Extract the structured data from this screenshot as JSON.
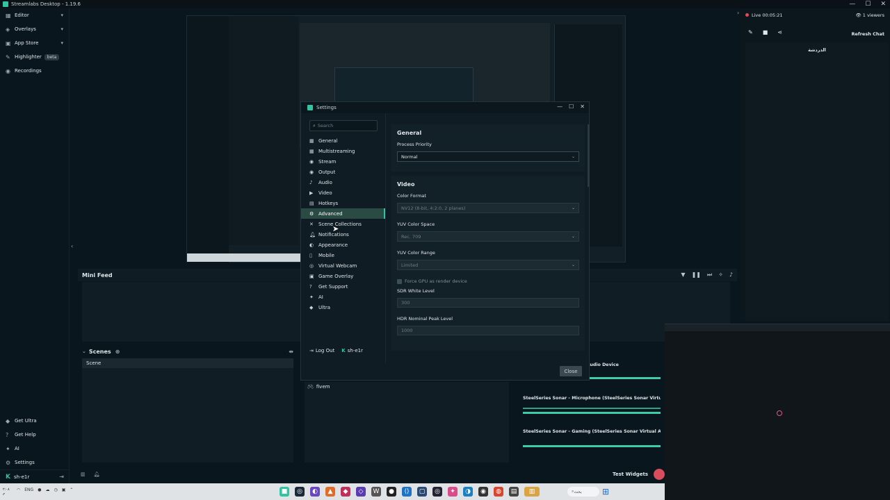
{
  "window": {
    "title": "Streamlabs Desktop - 1.19.6",
    "controls": [
      "—",
      "☐",
      "✕"
    ]
  },
  "left_nav": {
    "items": [
      {
        "label": "Editor",
        "icon": "editor-icon",
        "chevron": true
      },
      {
        "label": "Overlays",
        "icon": "overlays-icon",
        "chevron": true
      },
      {
        "label": "App Store",
        "icon": "app-store-icon",
        "chevron": true
      },
      {
        "label": "Highlighter",
        "icon": "highlighter-icon",
        "badge": "beta"
      },
      {
        "label": "Recordings",
        "icon": "recordings-icon"
      }
    ],
    "bottom_items": [
      {
        "label": "Get Ultra",
        "icon": "ultra-icon"
      },
      {
        "label": "Get Help",
        "icon": "help-icon"
      },
      {
        "label": "AI",
        "icon": "ai-icon"
      },
      {
        "label": "Settings",
        "icon": "gear-icon"
      }
    ],
    "user": "sh-e1r"
  },
  "mini_feed": {
    "label": "Mini Feed"
  },
  "scenes": {
    "label": "Scenes",
    "items": [
      "Scene"
    ]
  },
  "sources": {
    "items": [
      "fivem"
    ]
  },
  "mixer": {
    "items": [
      "SteelSeries Sonar Virtual Audio Device",
      "SteelSeries Sonar - Microphone (SteelSeries Sonar Virtual Audio Device)",
      "SteelSeries Sonar - Gaming (SteelSeries Sonar Virtual Audio Device)"
    ]
  },
  "chat": {
    "live": "Live 00:05:21",
    "viewers": "1 viewers",
    "refresh": "Refresh Chat",
    "heading": "الدردشة"
  },
  "footer": {
    "test_widgets": "Test Widgets"
  },
  "taskbar": {
    "lang": "ENG",
    "clock": "٢:٠٨ م",
    "search": "بحث"
  },
  "settings": {
    "title": "Settings",
    "search_placeholder": "Search",
    "menu": [
      {
        "label": "General",
        "icon": "general-icon"
      },
      {
        "label": "Multistreaming",
        "icon": "multistream-icon"
      },
      {
        "label": "Stream",
        "icon": "stream-icon"
      },
      {
        "label": "Output",
        "icon": "output-icon"
      },
      {
        "label": "Audio",
        "icon": "audio-icon"
      },
      {
        "label": "Video",
        "icon": "video-icon"
      },
      {
        "label": "Hotkeys",
        "icon": "hotkeys-icon"
      },
      {
        "label": "Advanced",
        "icon": "advanced-icon",
        "active": true
      },
      {
        "label": "Scene Collections",
        "icon": "scene-collections-icon"
      },
      {
        "label": "Notifications",
        "icon": "notifications-icon"
      },
      {
        "label": "Appearance",
        "icon": "appearance-icon"
      },
      {
        "label": "Mobile",
        "icon": "mobile-icon"
      },
      {
        "label": "Virtual Webcam",
        "icon": "webcam-icon"
      },
      {
        "label": "Game Overlay",
        "icon": "game-overlay-icon"
      },
      {
        "label": "Get Support",
        "icon": "support-icon"
      },
      {
        "label": "AI",
        "icon": "ai-icon"
      },
      {
        "label": "Ultra",
        "icon": "ultra-icon"
      }
    ],
    "logout": "Log Out",
    "user": "sh-e1r",
    "general": {
      "heading": "General",
      "process_priority_label": "Process Priority",
      "process_priority_value": "Normal"
    },
    "video": {
      "heading": "Video",
      "color_format_label": "Color Format",
      "color_format_value": "NV12 (8-bit, 4:2:0, 2 planes)",
      "yuv_space_label": "YUV Color Space",
      "yuv_space_value": "Rec. 709",
      "yuv_range_label": "YUV Color Range",
      "yuv_range_value": "Limited",
      "force_gpu_label": "Force GPU as render device",
      "sdr_label": "SDR White Level",
      "sdr_value": "300",
      "hdr_label": "HDR Nominal Peak Level",
      "hdr_value": "1000"
    },
    "close_label": "Close"
  },
  "colors": {
    "accent": "#31c3a2",
    "bg": "#09161d",
    "panel": "#0f1c23",
    "record": "#d94c5c"
  }
}
